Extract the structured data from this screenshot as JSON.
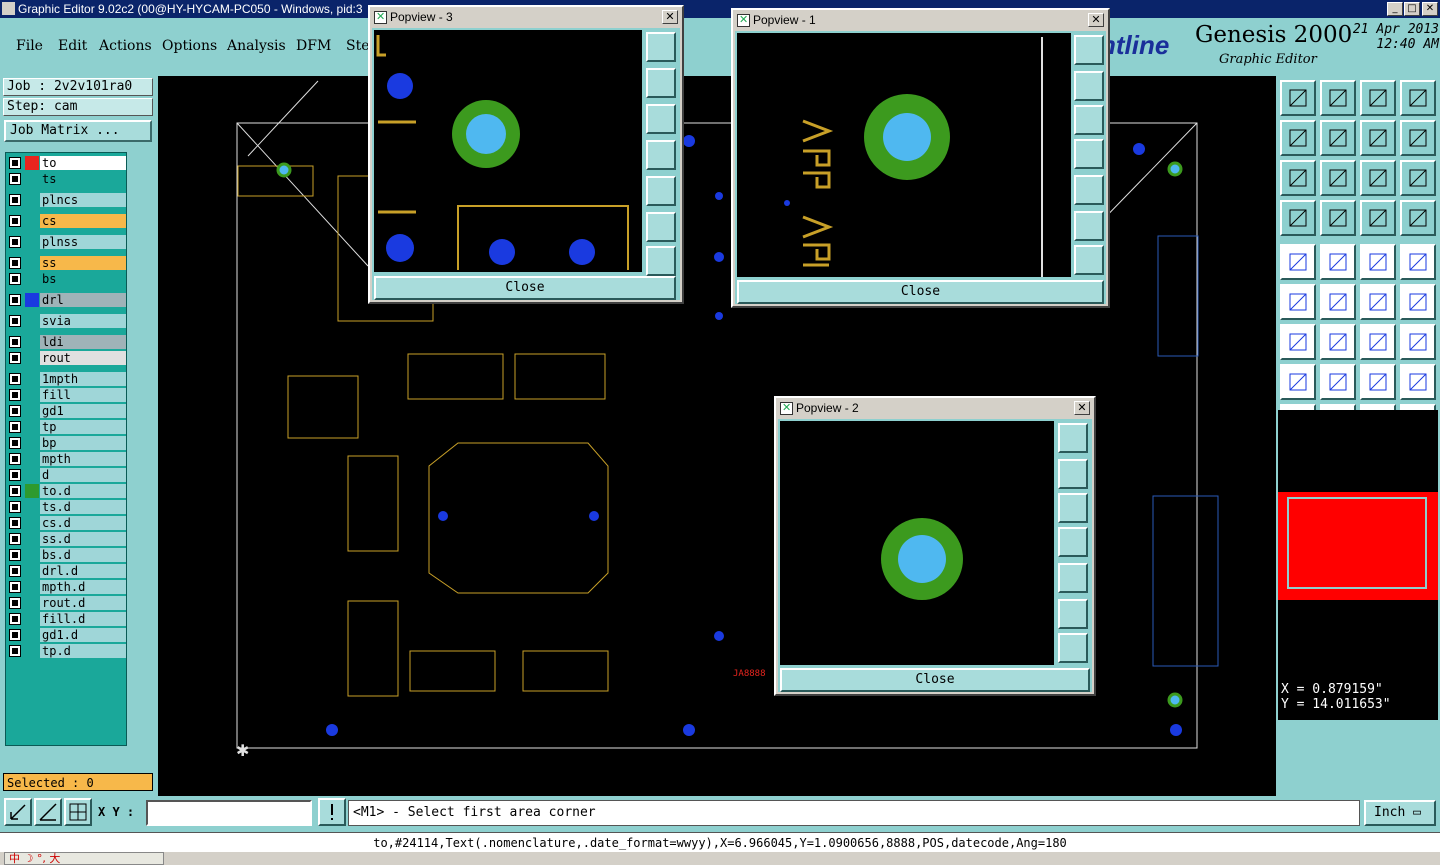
{
  "window": {
    "title": "Graphic Editor 9.02c2 (00@HY-HYCAM-PC050 - Windows, pid:3"
  },
  "menu": [
    "File",
    "Edit",
    "Actions",
    "Options",
    "Analysis",
    "DFM",
    "Ste"
  ],
  "brand": {
    "logo": "ntline",
    "product": "Genesis 2000",
    "subtitle": "Graphic Editor",
    "date": "21 Apr 2013",
    "time": "12:40 AM"
  },
  "job": {
    "job_label": "Job : 2v2v101ra0",
    "step_label": "Step: cam",
    "matrix_button": "Job Matrix ..."
  },
  "layers": [
    {
      "name": "to",
      "color": "#e8251e",
      "bg": "#ffffff"
    },
    {
      "name": "ts",
      "color": "#1aa89a",
      "bg": "#1aa89a"
    },
    {
      "name": "plncs",
      "color": "#1aa89a",
      "bg": "#9fd6d8"
    },
    {
      "name": "cs",
      "color": "#1aa89a",
      "bg": "#f7b84a"
    },
    {
      "name": "plnss",
      "color": "#1aa89a",
      "bg": "#9fd6d8"
    },
    {
      "name": "ss",
      "color": "#1aa89a",
      "bg": "#f7b84a"
    },
    {
      "name": "bs",
      "color": "#1aa89a",
      "bg": "#1aa89a"
    },
    {
      "name": "drl",
      "color": "#1a3ae0",
      "bg": "#9fb3b8"
    },
    {
      "name": "svia",
      "color": "#1aa89a",
      "bg": "#9fd6d8"
    },
    {
      "name": "ldi",
      "color": "#1aa89a",
      "bg": "#9fb3b8"
    },
    {
      "name": "rout",
      "color": "#1aa89a",
      "bg": "#e0e0e0"
    },
    {
      "name": "1mpth",
      "color": "#1aa89a",
      "bg": "#9fd6d8"
    },
    {
      "name": "fill",
      "color": "#1aa89a",
      "bg": "#9fd6d8"
    },
    {
      "name": "gd1",
      "color": "#1aa89a",
      "bg": "#9fd6d8"
    },
    {
      "name": "tp",
      "color": "#1aa89a",
      "bg": "#9fd6d8"
    },
    {
      "name": "bp",
      "color": "#1aa89a",
      "bg": "#9fd6d8"
    },
    {
      "name": "mpth",
      "color": "#1aa89a",
      "bg": "#9fd6d8"
    },
    {
      "name": "d",
      "color": "#1aa89a",
      "bg": "#9fd6d8"
    },
    {
      "name": "to.d",
      "color": "#2e9a2e",
      "bg": "#9fd6d8"
    },
    {
      "name": "ts.d",
      "color": "#1aa89a",
      "bg": "#9fd6d8"
    },
    {
      "name": "cs.d",
      "color": "#1aa89a",
      "bg": "#9fd6d8"
    },
    {
      "name": "ss.d",
      "color": "#1aa89a",
      "bg": "#9fd6d8"
    },
    {
      "name": "bs.d",
      "color": "#1aa89a",
      "bg": "#9fd6d8"
    },
    {
      "name": "drl.d",
      "color": "#1aa89a",
      "bg": "#9fd6d8"
    },
    {
      "name": "mpth.d",
      "color": "#1aa89a",
      "bg": "#9fd6d8"
    },
    {
      "name": "rout.d",
      "color": "#1aa89a",
      "bg": "#9fd6d8"
    },
    {
      "name": "fill.d",
      "color": "#1aa89a",
      "bg": "#9fd6d8"
    },
    {
      "name": "gd1.d",
      "color": "#1aa89a",
      "bg": "#9fd6d8"
    },
    {
      "name": "tp.d",
      "color": "#1aa89a",
      "bg": "#9fd6d8"
    }
  ],
  "selected": "Selected : 0",
  "coords": {
    "x": "X = 0.879159\"",
    "y": "Y = 14.011653\""
  },
  "cmd": {
    "xy_label": "X Y :",
    "xy_value": "",
    "message": "<M1> - Select first area corner",
    "unit": "Inch"
  },
  "status": "to,#24114,Text(.nomenclature,.date_format=wwyy),X=6.966045,Y=1.0900656,8888,POS,datecode,Ang=180",
  "ime": "中 ☽ °, 大",
  "popups": [
    {
      "title": "Popview - 3",
      "close": "Close"
    },
    {
      "title": "Popview - 1",
      "close": "Close"
    },
    {
      "title": "Popview - 2",
      "close": "Close"
    }
  ],
  "colors": {
    "panel": "#8ed0cf",
    "pad": "#4fb8f0",
    "ring": "#3c9a1e",
    "drill": "#1a3ae0",
    "trace": "#c8a028"
  }
}
